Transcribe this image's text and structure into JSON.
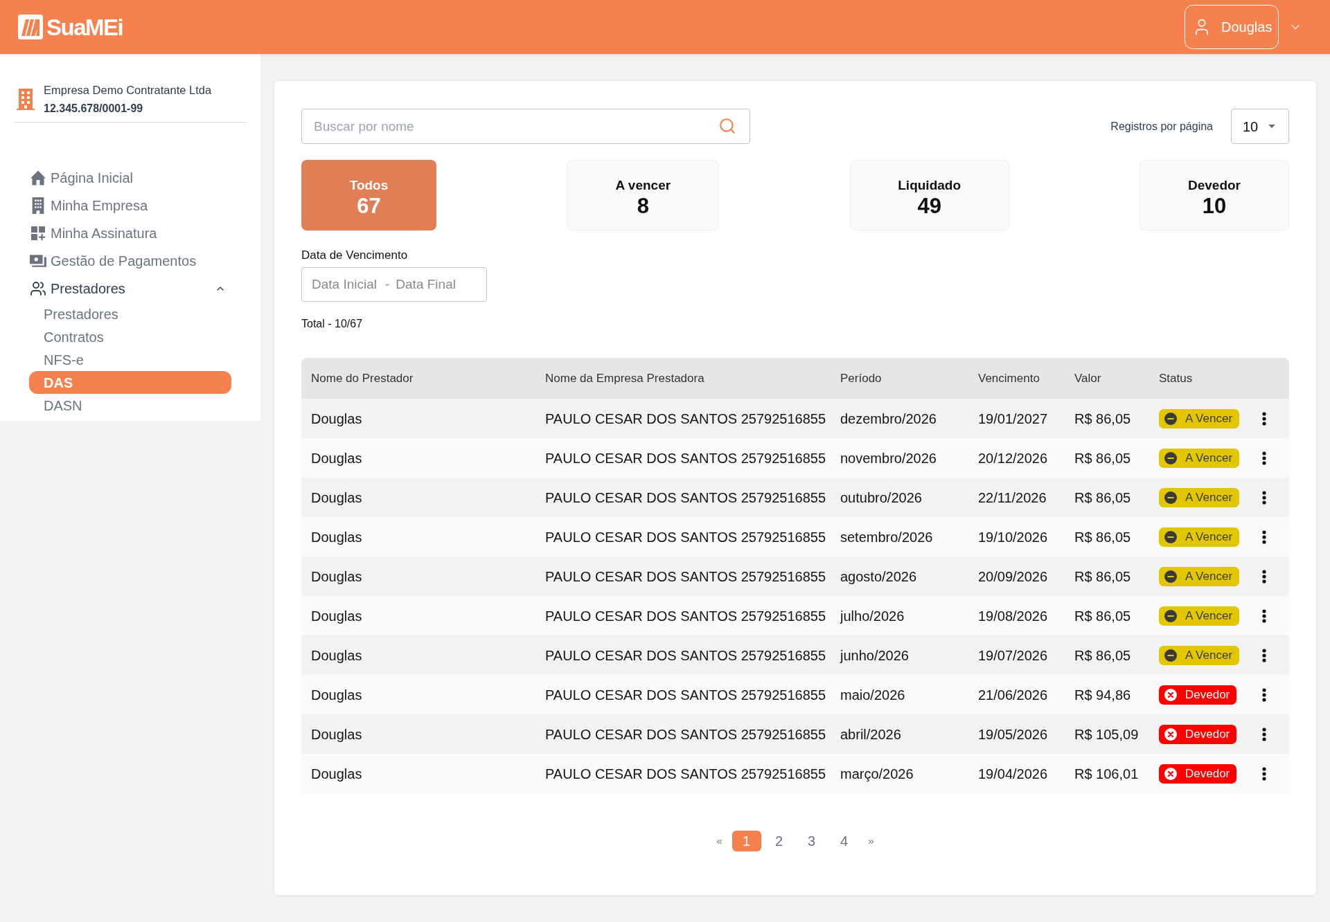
{
  "header": {
    "logo": "SuaMEi",
    "user": {
      "name": "Douglas"
    }
  },
  "sidebar": {
    "company": {
      "name": "Empresa Demo Contratante Ltda",
      "cnpj": "12.345.678/0001-99"
    },
    "items": [
      {
        "label": "Página Inicial",
        "selected": false
      },
      {
        "label": "Minha Empresa",
        "selected": false
      },
      {
        "label": "Minha Assinatura",
        "selected": false
      },
      {
        "label": "Gestão de Pagamentos",
        "selected": false
      },
      {
        "label": "Prestadores",
        "selected": false,
        "expanded": true,
        "children": [
          {
            "label": "Prestadores",
            "selected": false
          },
          {
            "label": "Contratos",
            "selected": false
          },
          {
            "label": "NFS-e",
            "selected": false
          },
          {
            "label": "DAS",
            "selected": true
          },
          {
            "label": "DASN",
            "selected": false
          }
        ]
      }
    ]
  },
  "search": {
    "placeholder": "Buscar por nome"
  },
  "page_size": {
    "label": "Registros por página",
    "value": "10"
  },
  "filters": [
    {
      "label": "Todos",
      "count": "67",
      "selected": true
    },
    {
      "label": "A vencer",
      "count": "8",
      "selected": false
    },
    {
      "label": "Liquidado",
      "count": "49",
      "selected": false
    },
    {
      "label": "Devedor",
      "count": "10",
      "selected": false
    }
  ],
  "due_date_filter": {
    "label": "Data de Vencimento",
    "start": {
      "placeholder": "Data Inicial"
    },
    "separator": "-",
    "end": {
      "placeholder": "Data Final"
    }
  },
  "total": "Total - 10/67",
  "table": {
    "columns": [
      "Nome do Prestador",
      "Nome da Empresa Prestadora",
      "Período",
      "Vencimento",
      "Valor",
      "Status"
    ],
    "rows": [
      {
        "provider": "Douglas",
        "company": "PAULO CESAR DOS SANTOS 25792516855",
        "period": "dezembro/2026",
        "due_date": "19/01/2027",
        "amount": "R$ 86,05",
        "status": {
          "label": "A Vencer",
          "kind": "pending"
        }
      },
      {
        "provider": "Douglas",
        "company": "PAULO CESAR DOS SANTOS 25792516855",
        "period": "novembro/2026",
        "due_date": "20/12/2026",
        "amount": "R$ 86,05",
        "status": {
          "label": "A Vencer",
          "kind": "pending"
        }
      },
      {
        "provider": "Douglas",
        "company": "PAULO CESAR DOS SANTOS 25792516855",
        "period": "outubro/2026",
        "due_date": "22/11/2026",
        "amount": "R$ 86,05",
        "status": {
          "label": "A Vencer",
          "kind": "pending"
        }
      },
      {
        "provider": "Douglas",
        "company": "PAULO CESAR DOS SANTOS 25792516855",
        "period": "setembro/2026",
        "due_date": "19/10/2026",
        "amount": "R$ 86,05",
        "status": {
          "label": "A Vencer",
          "kind": "pending"
        }
      },
      {
        "provider": "Douglas",
        "company": "PAULO CESAR DOS SANTOS 25792516855",
        "period": "agosto/2026",
        "due_date": "20/09/2026",
        "amount": "R$ 86,05",
        "status": {
          "label": "A Vencer",
          "kind": "pending"
        }
      },
      {
        "provider": "Douglas",
        "company": "PAULO CESAR DOS SANTOS 25792516855",
        "period": "julho/2026",
        "due_date": "19/08/2026",
        "amount": "R$ 86,05",
        "status": {
          "label": "A Vencer",
          "kind": "pending"
        }
      },
      {
        "provider": "Douglas",
        "company": "PAULO CESAR DOS SANTOS 25792516855",
        "period": "junho/2026",
        "due_date": "19/07/2026",
        "amount": "R$ 86,05",
        "status": {
          "label": "A Vencer",
          "kind": "pending"
        }
      },
      {
        "provider": "Douglas",
        "company": "PAULO CESAR DOS SANTOS 25792516855",
        "period": "maio/2026",
        "due_date": "21/06/2026",
        "amount": "R$ 94,86",
        "status": {
          "label": "Devedor",
          "kind": "overdue"
        }
      },
      {
        "provider": "Douglas",
        "company": "PAULO CESAR DOS SANTOS 25792516855",
        "period": "abril/2026",
        "due_date": "19/05/2026",
        "amount": "R$ 105,09",
        "status": {
          "label": "Devedor",
          "kind": "overdue"
        }
      },
      {
        "provider": "Douglas",
        "company": "PAULO CESAR DOS SANTOS 25792516855",
        "period": "março/2026",
        "due_date": "19/04/2026",
        "amount": "R$ 106,01",
        "status": {
          "label": "Devedor",
          "kind": "overdue"
        }
      }
    ]
  },
  "pagination": {
    "previous": "«",
    "pages": [
      {
        "label": "1",
        "selected": true
      },
      {
        "label": "2",
        "selected": false
      },
      {
        "label": "3",
        "selected": false
      },
      {
        "label": "4",
        "selected": false
      }
    ],
    "next": "»"
  }
}
